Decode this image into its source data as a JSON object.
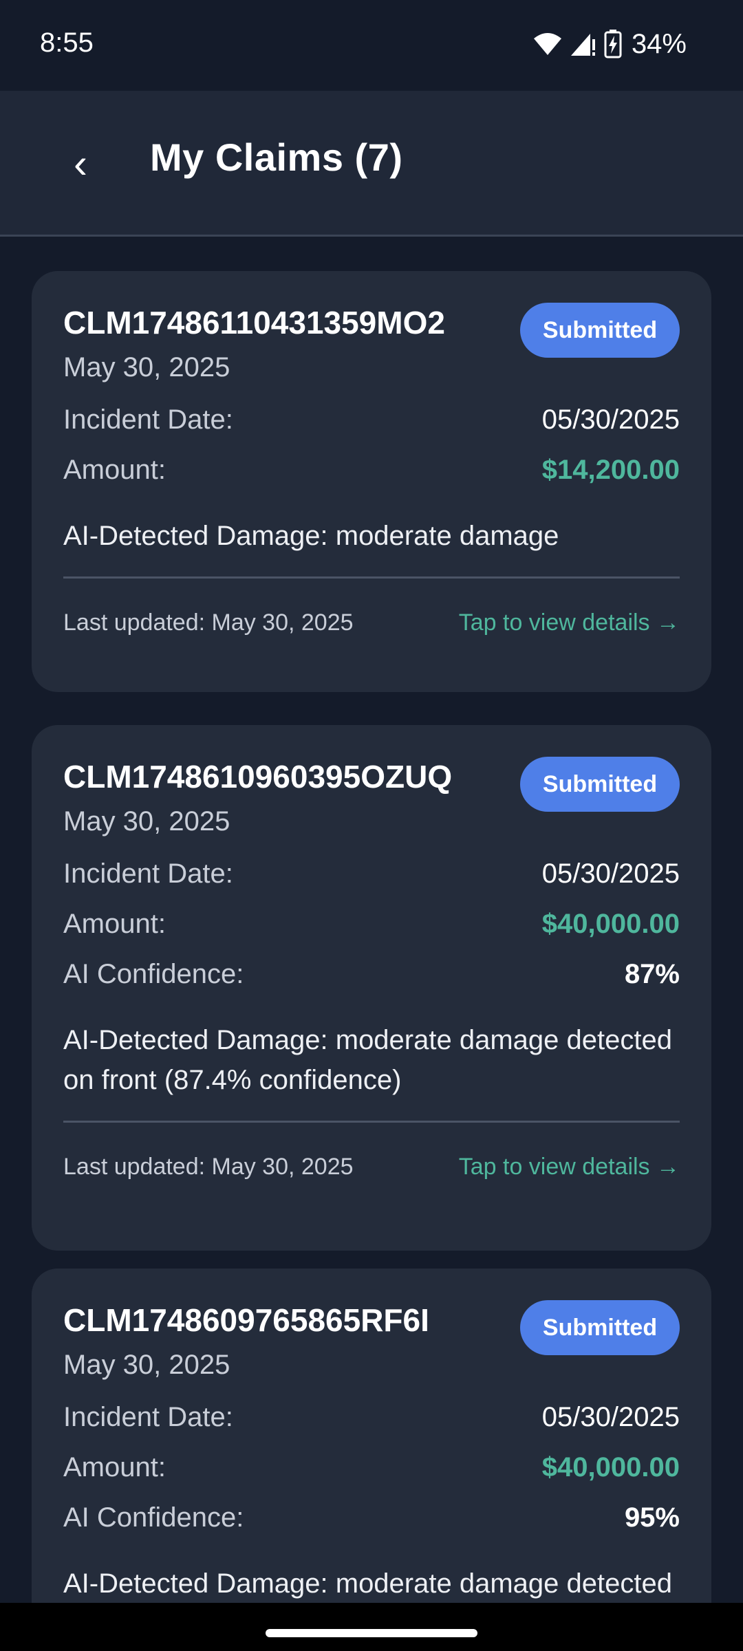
{
  "status_bar": {
    "time": "8:55",
    "battery": "34%",
    "icons": [
      "wifi-icon",
      "signal-icon",
      "battery-charging-icon"
    ]
  },
  "header": {
    "back_glyph": "‹",
    "title": "My Claims (7)"
  },
  "colors": {
    "background": "#141b2a",
    "card": "#242c3b",
    "accent_badge": "#4f7fe8",
    "amount_green": "#4fb79d"
  },
  "claims": [
    {
      "id": "CLM17486110431359MO2",
      "date": "May 30, 2025",
      "status": "Submitted",
      "incident_label": "Incident Date:",
      "incident_date": "05/30/2025",
      "amount_label": "Amount:",
      "amount": "$14,200.00",
      "damage": "AI-Detected Damage: moderate damage",
      "last_updated": "Last updated: May 30, 2025",
      "details_link": "Tap to view details →"
    },
    {
      "id": "CLM1748610960395OZUQ",
      "date": "May 30, 2025",
      "status": "Submitted",
      "incident_label": "Incident Date:",
      "incident_date": "05/30/2025",
      "amount_label": "Amount:",
      "amount": "$40,000.00",
      "confidence_label": "AI Confidence:",
      "confidence": "87%",
      "damage": "AI-Detected Damage: moderate damage detected on front (87.4% confidence)",
      "last_updated": "Last updated: May 30, 2025",
      "details_link": "Tap to view details →"
    },
    {
      "id": "CLM1748609765865RF6I",
      "date": "May 30, 2025",
      "status": "Submitted",
      "incident_label": "Incident Date:",
      "incident_date": "05/30/2025",
      "amount_label": "Amount:",
      "amount": "$40,000.00",
      "confidence_label": "AI Confidence:",
      "confidence": "95%",
      "damage": "AI-Detected Damage: moderate damage detected"
    }
  ]
}
